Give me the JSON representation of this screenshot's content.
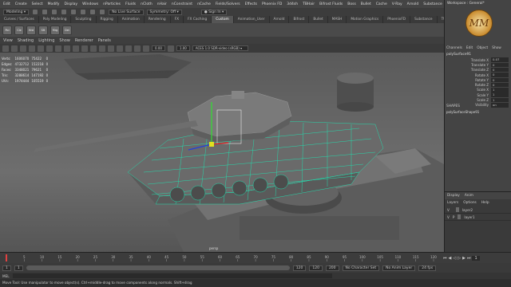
{
  "menubar": {
    "items": [
      "Edit",
      "Create",
      "Select",
      "Modify",
      "Display",
      "Windows",
      "nParticles",
      "Fluids",
      "nCloth",
      "nHair",
      "nConstraint",
      "nCache",
      "Fields/Solvers",
      "Effects",
      "Phoenix FD",
      "3d4sh",
      "TBHair",
      "Bifrost Fluids",
      "Boss",
      "Bullet",
      "Cache",
      "V-Ray",
      "Arnold",
      "Substance",
      "OpenFlight",
      "Help"
    ],
    "workspace_label": "Workspace : General*"
  },
  "statusline": {
    "mode": "Modeling",
    "live_surface": "No Live Surface",
    "symmetry": "Symmetry: Off",
    "signin": "Sign In"
  },
  "shelf": {
    "tabs": [
      "Curves / Surfaces",
      "Poly Modeling",
      "Sculpting",
      "Rigging",
      "Animation",
      "Rendering",
      "FX",
      "FX Caching",
      "Custom",
      "Animation_User",
      "Arnold",
      "Bifrost",
      "Bullet",
      "MASH",
      "Motion Graphics",
      "PhoenixFD",
      "Substance",
      "TURTLE_User",
      "V-Ray",
      "XGen"
    ],
    "active_tab": "Custom",
    "icons": [
      "Pol",
      "Cle",
      "Hrd",
      "Sft",
      "Mrg",
      "Del"
    ]
  },
  "panel": {
    "menu": [
      "View",
      "Shading",
      "Lighting",
      "Show",
      "Renderer",
      "Panels"
    ],
    "field1": "0.00",
    "field2": "1.00",
    "colorspace": "ACES 1.0 SDR-video (sRGB)"
  },
  "hud": {
    "rows": [
      {
        "label": "Verts:",
        "a": "1606070",
        "b": "75422",
        "c": "0"
      },
      {
        "label": "Edges:",
        "a": "4732712",
        "b": "152218",
        "c": "0"
      },
      {
        "label": "Faces:",
        "a": "3348021",
        "b": "79621",
        "c": "0"
      },
      {
        "label": "Tris:",
        "a": "3288614",
        "b": "147192",
        "c": "0"
      },
      {
        "label": "UVs:",
        "a": "1974444",
        "b": "105519",
        "c": "0"
      }
    ],
    "camera": "persp"
  },
  "channelbox": {
    "tabs": [
      "Channels",
      "Edit",
      "Object",
      "Show"
    ],
    "object": "polySurface91",
    "attrs": [
      {
        "name": "Translate X",
        "value": "0.07"
      },
      {
        "name": "Translate Y",
        "value": "0"
      },
      {
        "name": "Translate Z",
        "value": "0"
      },
      {
        "name": "Rotate X",
        "value": "0"
      },
      {
        "name": "Rotate Y",
        "value": "0"
      },
      {
        "name": "Rotate Z",
        "value": "0"
      },
      {
        "name": "Scale X",
        "value": "1"
      },
      {
        "name": "Scale Y",
        "value": "1"
      },
      {
        "name": "Scale Z",
        "value": "1"
      },
      {
        "name": "Visibility",
        "value": "on"
      }
    ],
    "shapes_header": "SHAPES",
    "shape_name": "polySurfaceShape91"
  },
  "layers": {
    "tabs": [
      "Display",
      "Anim"
    ],
    "menu": [
      "Layers",
      "Options",
      "Help"
    ],
    "items": [
      {
        "v": "V",
        "p": "",
        "name": "layer2"
      },
      {
        "v": "V",
        "p": "P",
        "name": "layer1"
      }
    ]
  },
  "timeline": {
    "ticks": [
      "1",
      "5",
      "10",
      "15",
      "20",
      "25",
      "30",
      "35",
      "40",
      "45",
      "50",
      "55",
      "60",
      "65",
      "70",
      "75",
      "80",
      "85",
      "90",
      "95",
      "100",
      "105",
      "110",
      "115",
      "120"
    ],
    "current": "1"
  },
  "range": {
    "start": "1",
    "inner_start": "1",
    "inner_end": "120",
    "end": "120",
    "outer_end": "200",
    "char_set": "No Character Set",
    "anim_layer": "No Anim Layer",
    "fps": "24 fps"
  },
  "mel": {
    "label": "MEL"
  },
  "help": {
    "text": "Move Tool: Use manipulator to move object(s). Ctrl+middle-drag to move components along normals. Shift+drag"
  },
  "colors": {
    "accent_green": "#22e0b0",
    "viewport_bg": "#5e5e5e",
    "panel_bg": "#444444"
  }
}
